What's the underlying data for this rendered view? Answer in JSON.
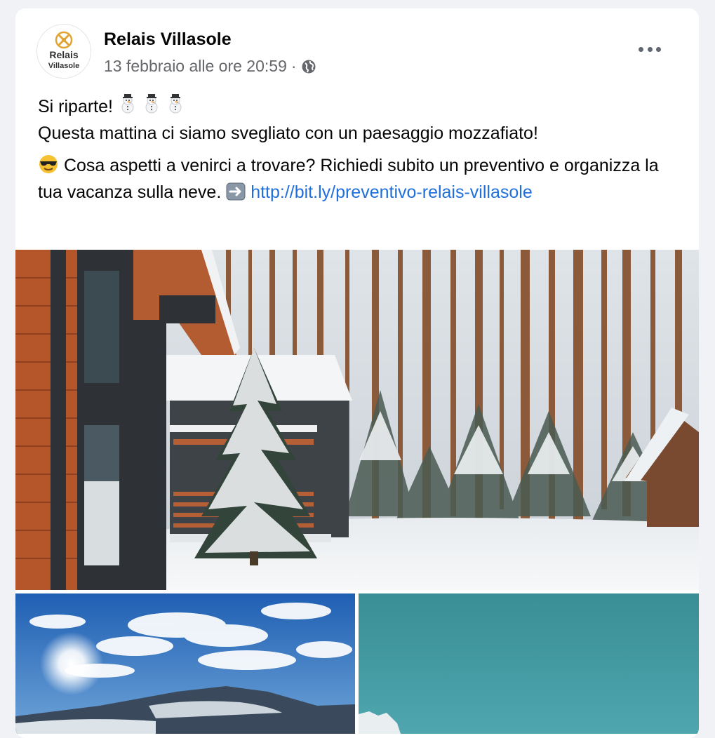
{
  "post": {
    "page_name": "Relais Villasole",
    "timestamp": "13 febbraio alle ore 20:59",
    "separator": "·",
    "privacy_icon": "globe-icon",
    "more_icon": "more-options-icon",
    "avatar": {
      "logo_line1": "Relais",
      "logo_line2": "Villasole"
    },
    "text": {
      "line1": "Si riparte!",
      "line1_emoji": "snowman-icon",
      "line2": "Questa mattina ci siamo svegliato con un paesaggio mozzafiato!",
      "para2_emoji": "sunglasses-face-icon",
      "para2": "Cosa aspetti a venirci a trovare? Richiedi subito un preventivo e organizza la tua vacanza sulla neve.",
      "arrow_emoji": "right-arrow-icon",
      "link": "http://bit.ly/preventivo-relais-villasole"
    },
    "photos": [
      "snowy-cabins-photo",
      "snowy-mountain-photo",
      "blue-sky-photo"
    ]
  }
}
